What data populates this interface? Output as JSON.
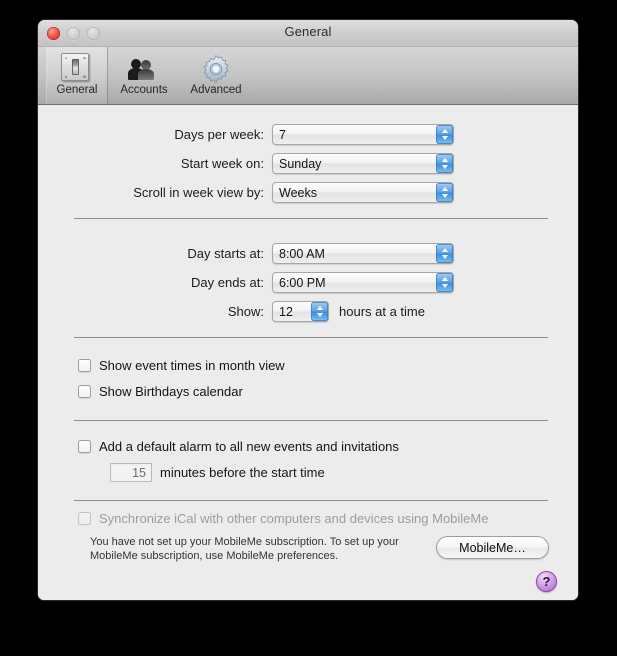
{
  "window": {
    "title": "General",
    "traffic_lights": [
      "close",
      "minimize",
      "zoom"
    ]
  },
  "toolbar": {
    "items": [
      {
        "label": "General",
        "icon": "switch-plate-icon",
        "selected": true
      },
      {
        "label": "Accounts",
        "icon": "people-icon",
        "selected": false
      },
      {
        "label": "Advanced",
        "icon": "gear-icon",
        "selected": false
      }
    ]
  },
  "settings": {
    "group_week": [
      {
        "label": "Days per week:",
        "value": "7"
      },
      {
        "label": "Start week on:",
        "value": "Sunday"
      },
      {
        "label": "Scroll in week view by:",
        "value": "Weeks"
      }
    ],
    "group_day": [
      {
        "label": "Day starts at:",
        "value": "8:00 AM"
      },
      {
        "label": "Day ends at:",
        "value": "6:00 PM"
      }
    ],
    "show_row": {
      "label": "Show:",
      "value": "12",
      "suffix": "hours at a time"
    },
    "checkboxes": [
      {
        "label": "Show event times in month view",
        "checked": false,
        "enabled": true
      },
      {
        "label": "Show Birthdays calendar",
        "checked": false,
        "enabled": true
      }
    ],
    "alarm": {
      "checkbox_label": "Add a default alarm to all new events and invitations",
      "checked": false,
      "minutes_value": "15",
      "minutes_suffix": "minutes before the start time"
    },
    "mobileme": {
      "checkbox_label": "Synchronize iCal with other computers and devices using MobileMe",
      "checked": false,
      "enabled": false,
      "description_line1": "You have not set up your MobileMe subscription. To set up your",
      "description_line2": "MobileMe subscription, use MobileMe preferences.",
      "button_label": "MobileMe…"
    },
    "help_button": "?"
  },
  "colors": {
    "window_bg": "#ececec",
    "toolbar_top": "#d6d6d6",
    "toolbar_bottom": "#a9a9a9",
    "accent_blue": "#3e8fdd",
    "help_purple": "#a659cc",
    "close_red": "#f4564b"
  }
}
